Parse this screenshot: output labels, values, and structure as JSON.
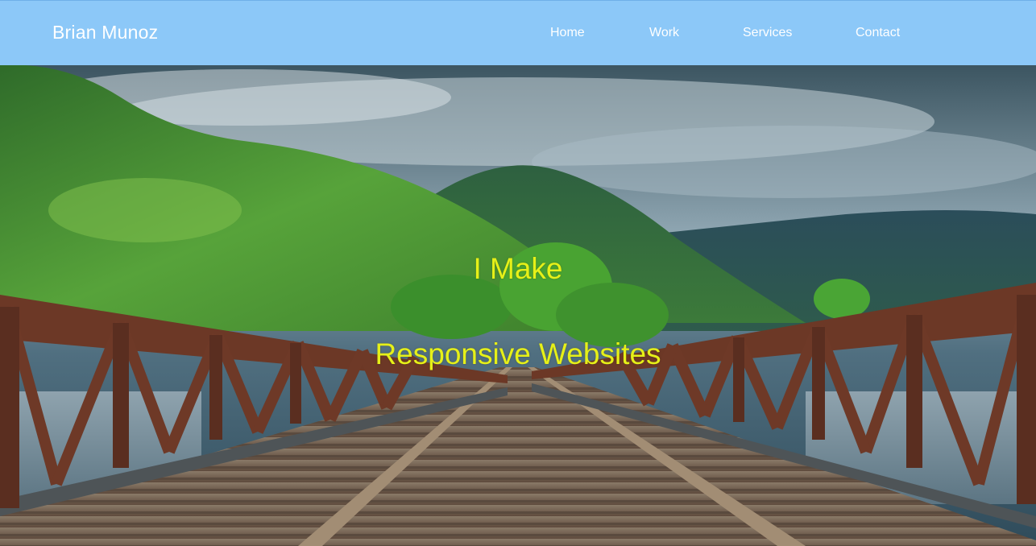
{
  "header": {
    "brand": "Brian Munoz",
    "nav": [
      {
        "label": "Home"
      },
      {
        "label": "Work"
      },
      {
        "label": "Services"
      },
      {
        "label": "Contact"
      }
    ]
  },
  "hero": {
    "line1": "I Make",
    "line2": "Responsive Websites"
  },
  "colors": {
    "navbar": "#8cc8f8",
    "nav_text": "#ffffff",
    "hero_text": "#e6f018"
  }
}
